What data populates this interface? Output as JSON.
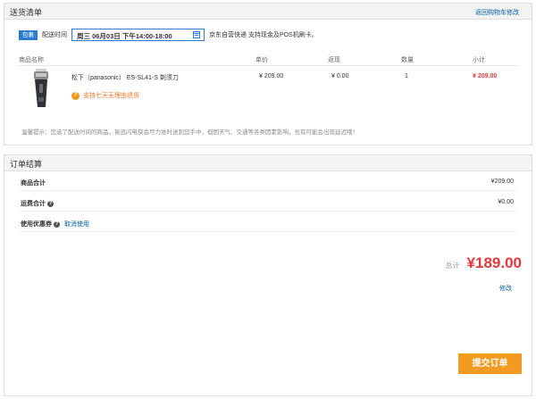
{
  "shipping": {
    "title": "送货清单",
    "return_link": "返回购物车修改",
    "tag": "包裹",
    "time_label": "配送时间",
    "date_value": "周三 06月03日 下午14:00-18:00",
    "note": "京东自营快递 支持现金及POS机刷卡。",
    "columns": {
      "name": "商品名称",
      "price": "单价",
      "points": "返现",
      "qty": "数量",
      "subtotal": "小计"
    },
    "item": {
      "name": "松下（panasonic） ES-SL41-S 剃须刀",
      "price": "¥ 209.00",
      "points": "¥ 0.00",
      "qty": "1",
      "subtotal": "¥ 209.00",
      "badge_icon": "7",
      "badge_text": "支持七天无理由退货"
    },
    "tip": "温馨提示：您选了配送时间的商品，易迅闪电侠会尽力准时送到您手中，但因天气、交通等各类因素影响，也有可能会出现延迟哦！"
  },
  "settle": {
    "title": "订单结算",
    "goods_label": "商品合计",
    "goods_value": "¥209.00",
    "freight_label": "运费合计",
    "freight_value": "¥0.00",
    "coupon_label": "使用优惠券",
    "coupon_link": "取消使用",
    "total_label": "总计",
    "total_value": "¥189.00",
    "modify": "修改",
    "submit": "提交订单"
  },
  "colors": {
    "accent_red": "#e4393c",
    "accent_blue": "#2a7bd2",
    "submit_orange": "#f39a21",
    "badge_orange": "#f19b1b"
  },
  "icons": {
    "calendar": "calendar-icon",
    "question": "question-icon",
    "badge": "seven-day-return-icon"
  }
}
